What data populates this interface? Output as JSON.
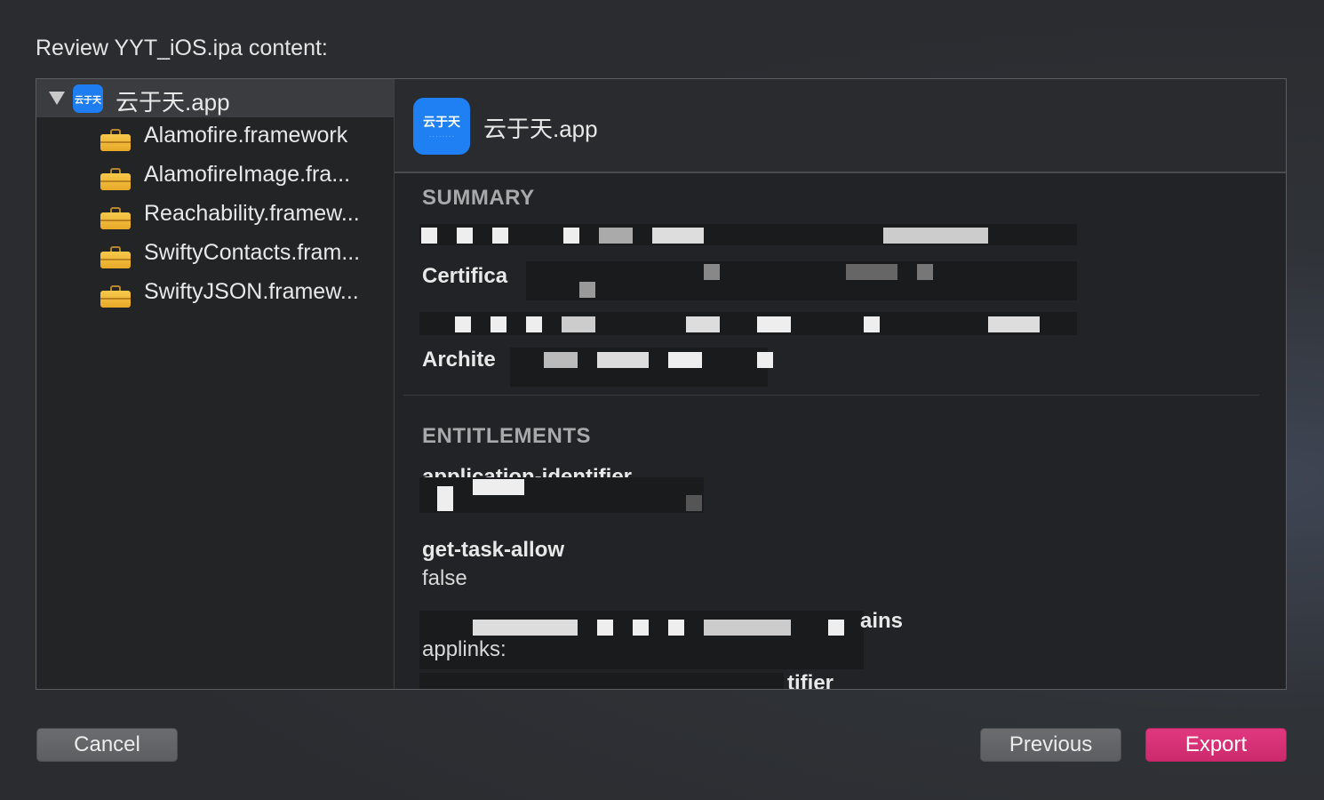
{
  "dialog": {
    "title": "Review YYT_iOS.ipa content:"
  },
  "tree": {
    "root": {
      "label": "云于天.app",
      "icon": "app-icon"
    },
    "items": [
      {
        "label": "Alamofire.framework",
        "icon": "briefcase-icon"
      },
      {
        "label": "AlamofireImage.fra...",
        "icon": "briefcase-icon"
      },
      {
        "label": "Reachability.framew...",
        "icon": "briefcase-icon"
      },
      {
        "label": "SwiftyContacts.fram...",
        "icon": "briefcase-icon"
      },
      {
        "label": "SwiftyJSON.framew...",
        "icon": "briefcase-icon"
      }
    ]
  },
  "detail": {
    "title": "云于天.app",
    "summary_heading": "SUMMARY",
    "certificate_label": "Certifica",
    "architectures_label": "Archite",
    "entitlements_heading": "ENTITLEMENTS",
    "app_identifier_label": "application-identifier",
    "get_task_allow_label": "get-task-allow",
    "get_task_allow_value": "false",
    "associated_domains_label_tail": "ains",
    "applinks_value": "applinks:",
    "team_identifier_label_tail": "tifier"
  },
  "buttons": {
    "cancel": "Cancel",
    "previous": "Previous",
    "export": "Export"
  },
  "colors": {
    "accent": "#d8316f",
    "background": "#2b2c30",
    "panel": "#222326"
  }
}
